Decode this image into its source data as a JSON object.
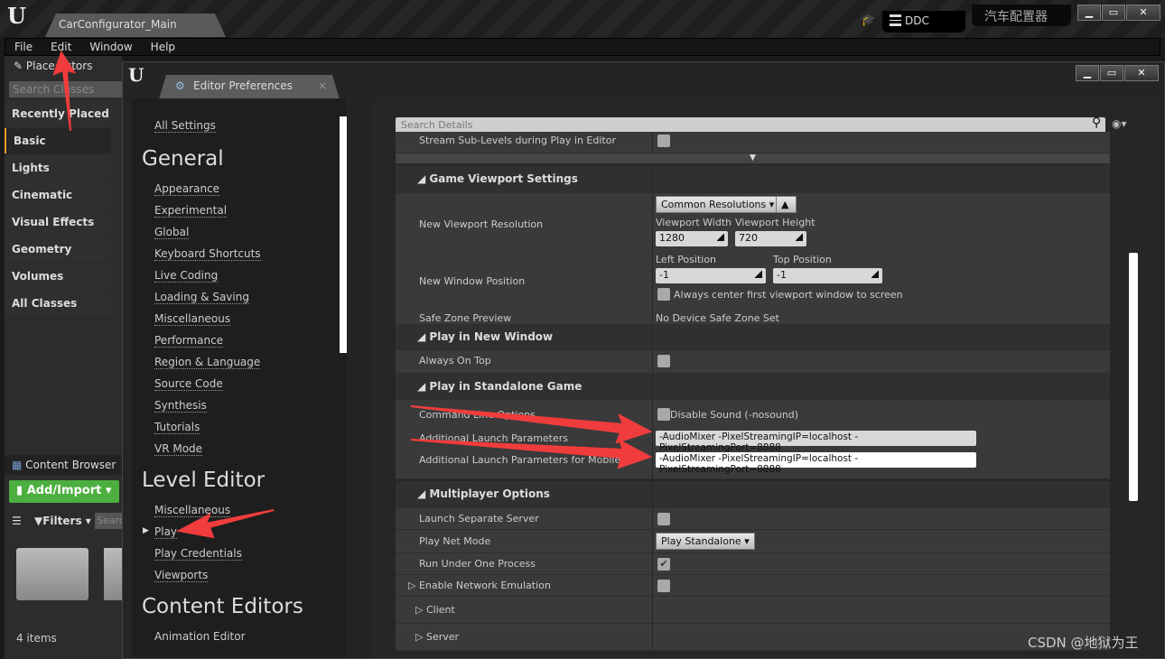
{
  "main_window": {
    "title": "CarConfigurator_Main",
    "ddc_label": "DDC",
    "project_name": "汽车配置器",
    "menu": [
      "File",
      "Edit",
      "Window",
      "Help"
    ]
  },
  "place_actors": {
    "title": "Place Actors",
    "search_placeholder": "Search Classes",
    "categories": [
      "Recently Placed",
      "Basic",
      "Lights",
      "Cinematic",
      "Visual Effects",
      "Geometry",
      "Volumes",
      "All Classes"
    ],
    "selected": "Basic"
  },
  "content_browser": {
    "title": "Content Browser",
    "add_import": "Add/Import",
    "filters": "Filters",
    "search_placeholder": "Search",
    "item_count": "4 items"
  },
  "prefs": {
    "tab_title": "Editor Preferences",
    "nav": {
      "all_settings": "All Settings",
      "general": {
        "heading": "General",
        "items": [
          "Appearance",
          "Experimental",
          "Global",
          "Keyboard Shortcuts",
          "Live Coding",
          "Loading & Saving",
          "Miscellaneous",
          "Performance",
          "Region & Language",
          "Source Code",
          "Synthesis",
          "Tutorials",
          "VR Mode"
        ]
      },
      "level_editor": {
        "heading": "Level Editor",
        "items": [
          "Miscellaneous",
          "Play",
          "Play Credentials",
          "Viewports"
        ],
        "selected": "Play"
      },
      "content_editors": {
        "heading": "Content Editors",
        "items": [
          "Animation Editor"
        ]
      }
    },
    "details": {
      "search_placeholder": "Search Details",
      "stream_sublevels": "Stream Sub-Levels during Play in Editor",
      "game_viewport": {
        "heading": "Game Viewport Settings",
        "new_viewport_resolution": "New Viewport Resolution",
        "common_resolutions": "Common Resolutions",
        "viewport_width_label": "Viewport Width",
        "viewport_width": "1280",
        "viewport_height_label": "Viewport Height",
        "viewport_height": "720",
        "new_window_position": "New Window Position",
        "left_position_label": "Left Position",
        "left_position": "-1",
        "top_position_label": "Top Position",
        "top_position": "-1",
        "always_center": "Always center first viewport window to screen",
        "safe_zone_preview": "Safe Zone Preview",
        "safe_zone_value": "No Device Safe Zone Set"
      },
      "play_new_window": {
        "heading": "Play in New Window",
        "always_on_top": "Always On Top"
      },
      "play_standalone": {
        "heading": "Play in Standalone Game",
        "command_line_options": "Command Line Options",
        "disable_sound": "Disable Sound (-nosound)",
        "additional_launch": "Additional Launch Parameters",
        "additional_launch_value": "-AudioMixer -PixelStreamingIP=localhost -PixelStreamingPort=8888",
        "additional_launch_mobile": "Additional Launch Parameters for Mobile",
        "additional_launch_mobile_value": "-AudioMixer -PixelStreamingIP=localhost -PixelStreamingPort=8888"
      },
      "multiplayer": {
        "heading": "Multiplayer Options",
        "launch_separate_server": "Launch Separate Server",
        "play_net_mode": "Play Net Mode",
        "play_net_mode_value": "Play Standalone",
        "run_under_one_process": "Run Under One Process",
        "run_under_one_process_checked": true,
        "enable_network_emulation": "Enable Network Emulation",
        "client": "Client",
        "server": "Server"
      }
    }
  },
  "watermark": "CSDN @地狱为王",
  "colors": {
    "accent_green": "#4caf3f",
    "arrow_red": "#f03c3c",
    "selected_orange": "#e5a02a"
  }
}
